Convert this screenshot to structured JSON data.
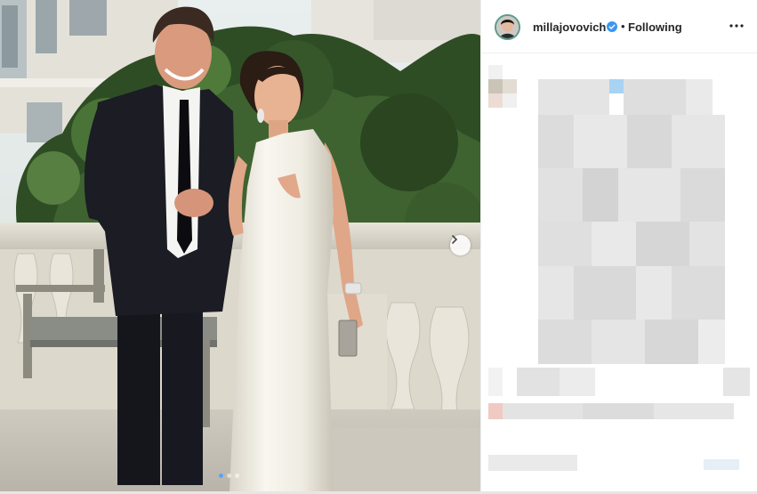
{
  "post": {
    "username": "millajovovich",
    "separator": "•",
    "follow_status": "Following",
    "verified": true,
    "colors": {
      "verified_badge": "#3897f0",
      "story_ring": "#5a9c8e",
      "text": "#262626"
    },
    "icons": {
      "more": "more-horizontal-icon",
      "next": "chevron-right-icon",
      "verified": "verified-badge-icon"
    }
  },
  "carousel": {
    "slide_count": 3,
    "active_index": 0
  }
}
